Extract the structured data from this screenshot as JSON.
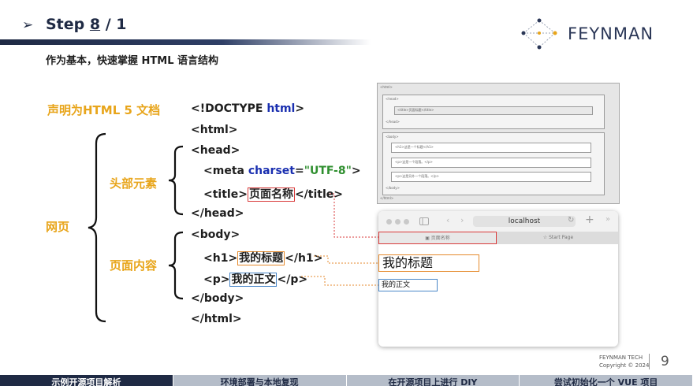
{
  "header": {
    "arrow": "➢",
    "step_prefix": "Step",
    "step_current": "8",
    "step_total": "/ 1",
    "subtitle": "作为基本，快速掌握 HTML 语言结构",
    "logo_text": "FEYNMAN"
  },
  "labels": {
    "doctype": "声明为HTML 5 文档",
    "head_elements": "头部元素",
    "webpage": "网页",
    "page_content": "页面内容"
  },
  "code": {
    "doctype_open": "<!DOCTYPE ",
    "doctype_kw": "html",
    "doctype_close": ">",
    "html_open": "<html>",
    "head_open": "<head>",
    "meta_tag": "<meta ",
    "meta_attr": "charset",
    "meta_eq": "=",
    "meta_value": "\"UTF-8\"",
    "meta_close": ">",
    "title_open": "<title>",
    "title_text": "页面名称",
    "title_close": "</title>",
    "head_close": "</head>",
    "body_open": "<body>",
    "h1_open": "<h1>",
    "h1_text": "我的标题",
    "h1_close": "</h1>",
    "p_open": "<p>",
    "p_text": "我的正文",
    "p_close": "</p>",
    "body_close": "</body>",
    "html_close": "</html>"
  },
  "dom_preview": {
    "html": "<html>",
    "head": "<head>",
    "title": "<title>页面标题</title>",
    "head_end": "</head>",
    "body": "<body>",
    "h1": "<h1>这是一个标题</h1>",
    "p1": "<p>这是一个段落。</p>",
    "p2": "<p>这是另外一个段落。</p>",
    "body_end": "</body>",
    "html_end": "</html>"
  },
  "browser": {
    "url": "localhost",
    "tab_active": "页面名称",
    "tab_start": "Start Page",
    "h1": "我的标题",
    "p": "我的正文"
  },
  "footer": {
    "company": "FEYNMAN TECH",
    "copyright": "Copyright © 2024",
    "page_number": "9"
  },
  "nav": [
    {
      "label": "示例开源项目解析"
    },
    {
      "label": "环境部署与本地复现"
    },
    {
      "label": "在开源项目上进行 DIY"
    },
    {
      "label": "尝试初始化一个 VUE 项目"
    }
  ],
  "colors": {
    "navy": "#1f2a44",
    "label_orange": "#e8a51b",
    "keyword_blue": "#1a2fb0",
    "string_green": "#2f8f2f",
    "highlight_red": "#d93a3a",
    "highlight_orange": "#e58a2c",
    "highlight_blue": "#4a87c8"
  }
}
